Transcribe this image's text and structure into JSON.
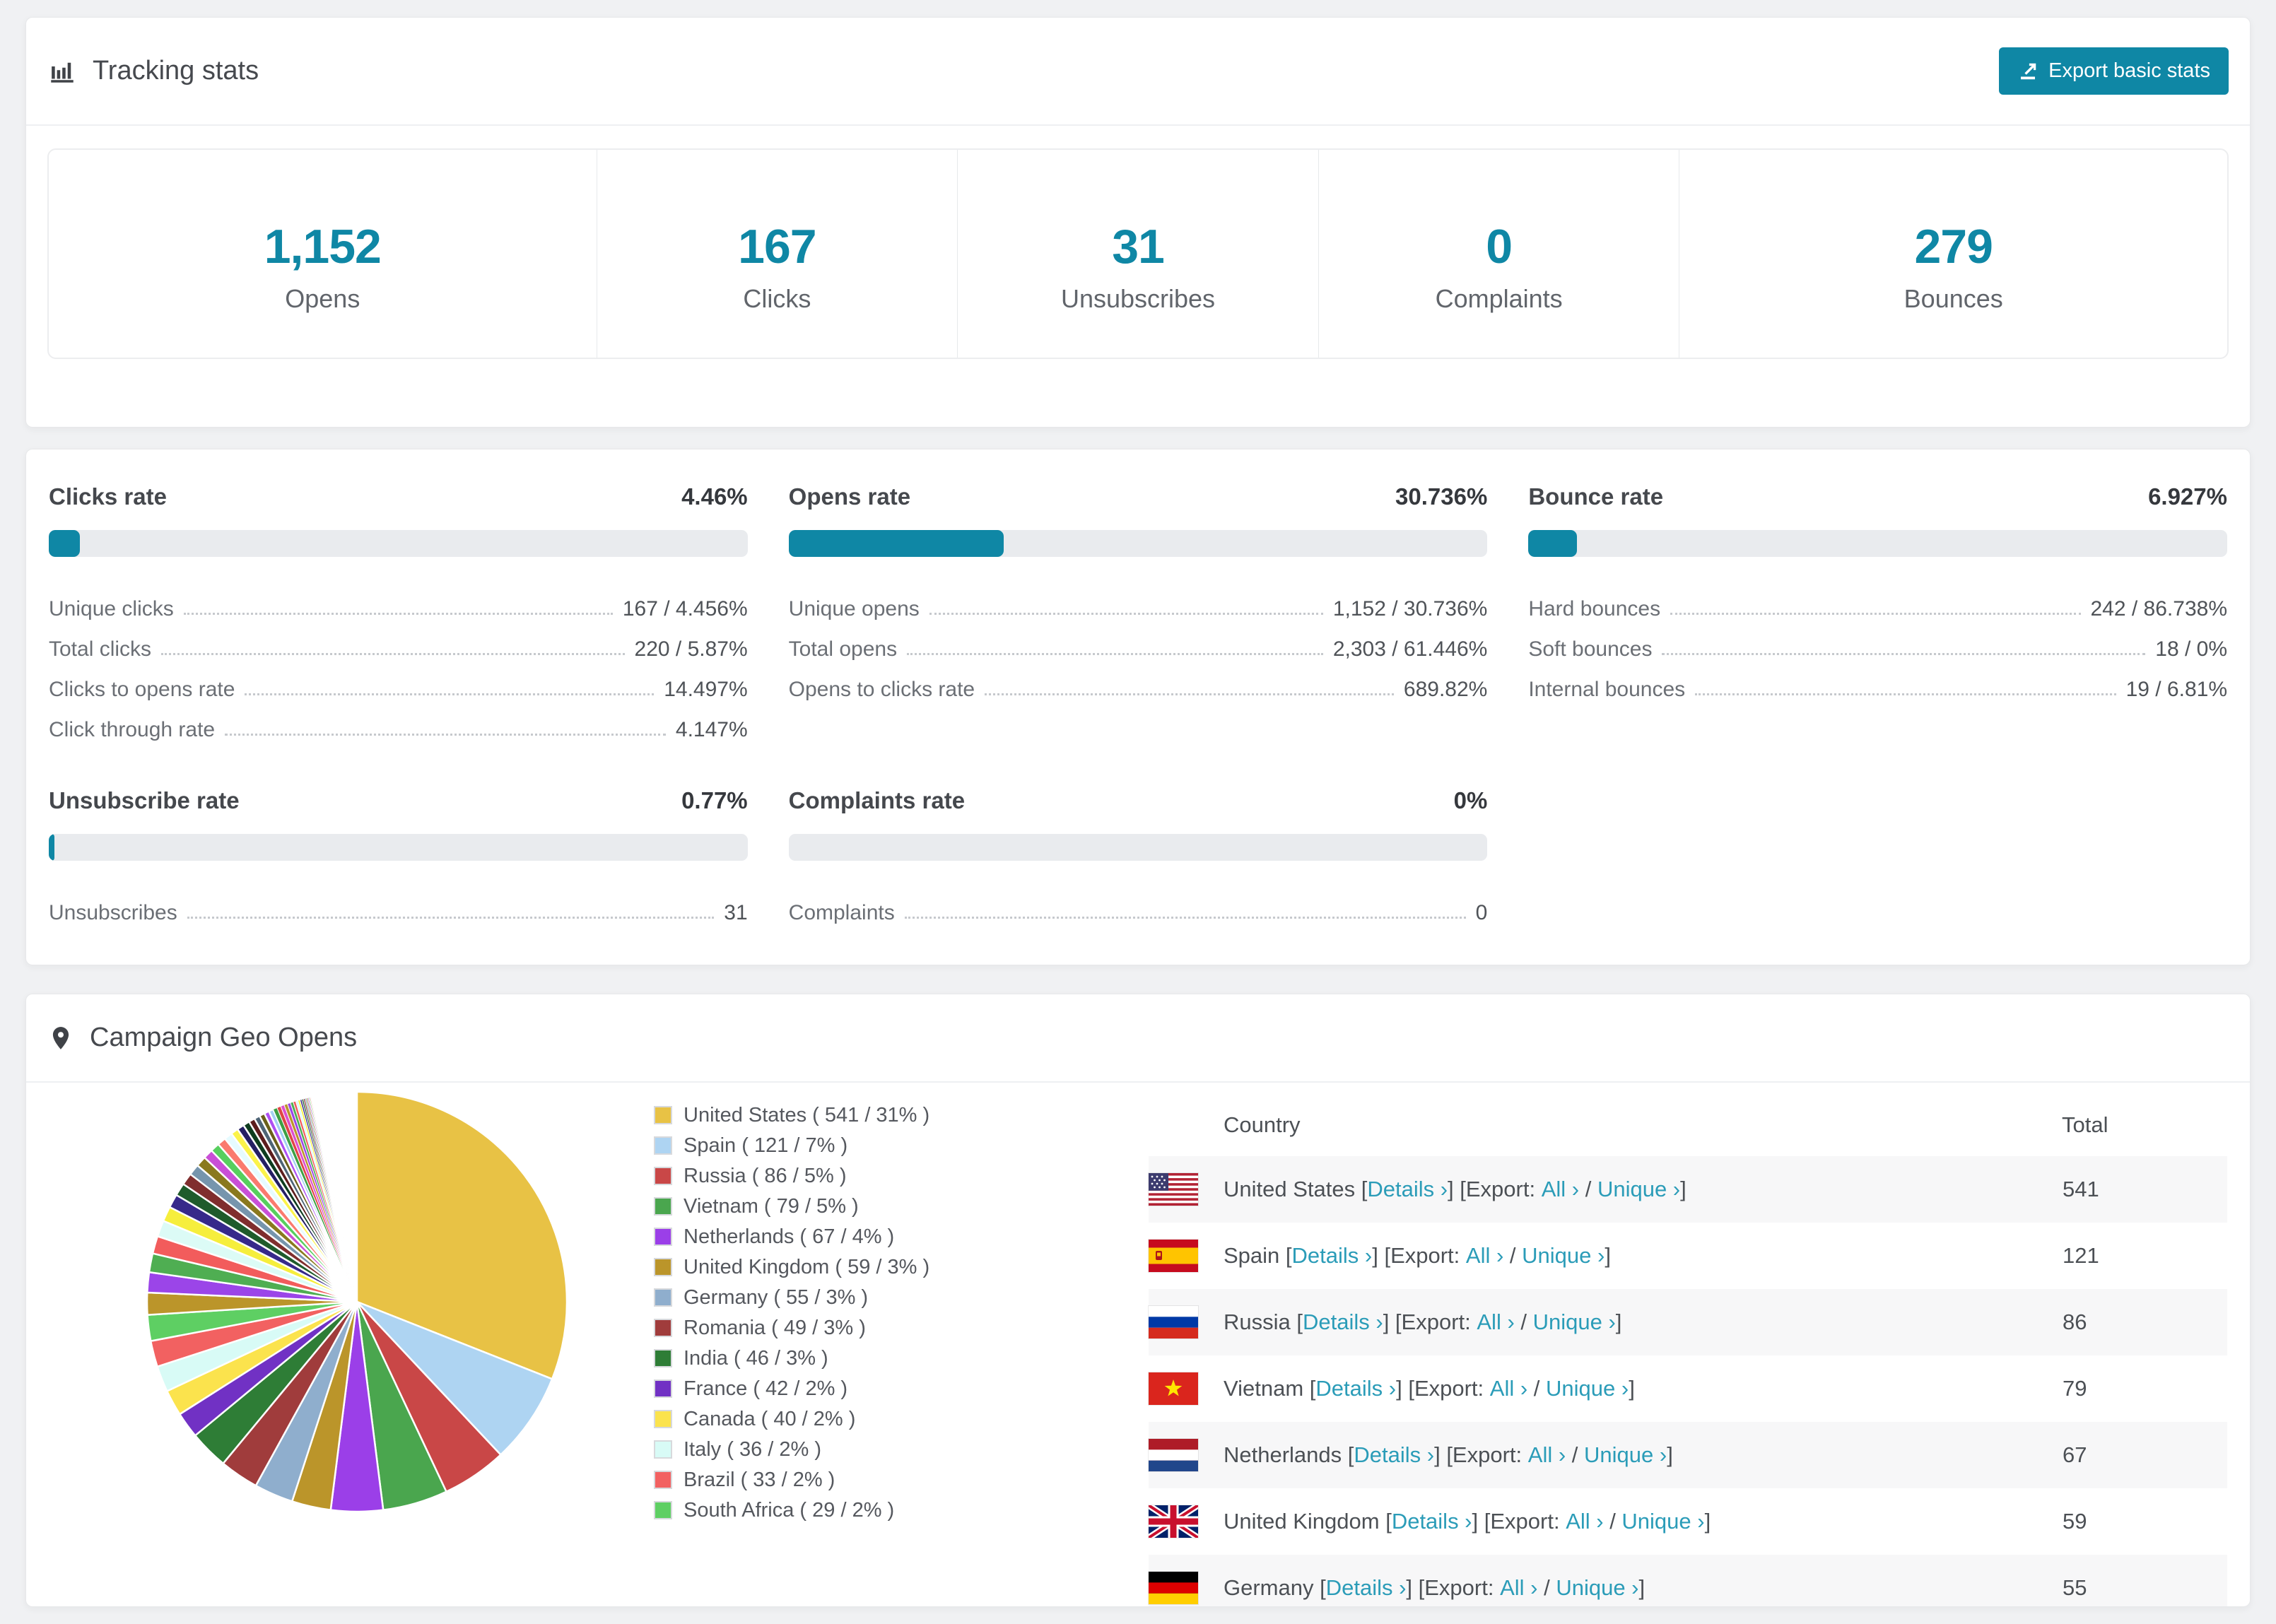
{
  "accent": "#0f87a5",
  "link_color": "#2b9cb8",
  "stripe_color": "#f7f7f8",
  "tracking": {
    "title": "Tracking stats",
    "export_label": "Export basic stats",
    "summary": [
      {
        "value": "1,152",
        "label": "Opens"
      },
      {
        "value": "167",
        "label": "Clicks"
      },
      {
        "value": "31",
        "label": "Unsubscribes"
      },
      {
        "value": "0",
        "label": "Complaints"
      },
      {
        "value": "279",
        "label": "Bounces"
      }
    ]
  },
  "rates": [
    {
      "title": "Clicks rate",
      "value": "4.46%",
      "percent": 4.46,
      "rows": [
        [
          "Unique clicks",
          "167 / 4.456%"
        ],
        [
          "Total clicks",
          "220 / 5.87%"
        ],
        [
          "Clicks to opens rate",
          "14.497%"
        ],
        [
          "Click through rate",
          "4.147%"
        ]
      ]
    },
    {
      "title": "Opens rate",
      "value": "30.736%",
      "percent": 30.736,
      "rows": [
        [
          "Unique opens",
          "1,152 / 30.736%"
        ],
        [
          "Total opens",
          "2,303 / 61.446%"
        ],
        [
          "Opens to clicks rate",
          "689.82%"
        ]
      ]
    },
    {
      "title": "Bounce rate",
      "value": "6.927%",
      "percent": 6.927,
      "rows": [
        [
          "Hard bounces",
          "242 / 86.738%"
        ],
        [
          "Soft bounces",
          "18 / 0%"
        ],
        [
          "Internal bounces",
          "19 / 6.81%"
        ]
      ]
    },
    {
      "title": "Unsubscribe rate",
      "value": "0.77%",
      "percent": 0.77,
      "rows": [
        [
          "Unsubscribes",
          "31"
        ]
      ]
    },
    {
      "title": "Complaints rate",
      "value": "0%",
      "percent": 0,
      "rows": [
        [
          "Complaints",
          "0"
        ]
      ]
    }
  ],
  "geo": {
    "title": "Campaign Geo Opens",
    "links": {
      "details": "Details ›",
      "export_prefix": "Export:",
      "all": "All ›",
      "unique": "Unique ›"
    },
    "table": {
      "columns": [
        "Country",
        "Total"
      ]
    }
  },
  "chart_data": {
    "type": "pie",
    "title": "Campaign Geo Opens",
    "legend_position": "right",
    "countries": [
      {
        "name": "United States",
        "count": 541,
        "pct": 31,
        "color": "#e8c245",
        "flag": "us"
      },
      {
        "name": "Spain",
        "count": 121,
        "pct": 7,
        "color": "#aed4f2",
        "flag": "es"
      },
      {
        "name": "Russia",
        "count": 86,
        "pct": 5,
        "color": "#c94747",
        "flag": "ru"
      },
      {
        "name": "Vietnam",
        "count": 79,
        "pct": 5,
        "color": "#4aa64e",
        "flag": "vn"
      },
      {
        "name": "Netherlands",
        "count": 67,
        "pct": 4,
        "color": "#9b3fe8",
        "flag": "nl"
      },
      {
        "name": "United Kingdom",
        "count": 59,
        "pct": 3,
        "color": "#bb952a",
        "flag": "gb"
      },
      {
        "name": "Germany",
        "count": 55,
        "pct": 3,
        "color": "#8faecd",
        "flag": "de"
      },
      {
        "name": "Romania",
        "count": 49,
        "pct": 3,
        "color": "#a03c3c"
      },
      {
        "name": "India",
        "count": 46,
        "pct": 3,
        "color": "#2e7d36"
      },
      {
        "name": "France",
        "count": 42,
        "pct": 2,
        "color": "#7131c4"
      },
      {
        "name": "Canada",
        "count": 40,
        "pct": 2,
        "color": "#fbe34d"
      },
      {
        "name": "Italy",
        "count": 36,
        "pct": 2,
        "color": "#d8fbf6"
      },
      {
        "name": "Brazil",
        "count": 33,
        "pct": 2,
        "color": "#f26161"
      },
      {
        "name": "South Africa",
        "count": 29,
        "pct": 2,
        "color": "#5ecf63"
      }
    ],
    "table_rows": 7,
    "others_pct": [
      1.7,
      1.55,
      1.45,
      1.35,
      1.25,
      1.15,
      1.05,
      0.98,
      0.92,
      0.86,
      0.8,
      0.75,
      0.7,
      0.66,
      0.62,
      0.58,
      0.54,
      0.5,
      0.47,
      0.44,
      0.41,
      0.38,
      0.35,
      0.32,
      0.3,
      0.28,
      0.26,
      0.24,
      0.22,
      0.2,
      0.18,
      0.16,
      0.14,
      0.13,
      0.12,
      0.11,
      0.1,
      0.09,
      0.08,
      0.07,
      0.06,
      0.05,
      0.05,
      0.04,
      0.04,
      0.03
    ],
    "others_palette": [
      "#bb952a",
      "#9b45e8",
      "#4fae52",
      "#f25c5c",
      "#dcfbf6",
      "#f6ee3c",
      "#37298a",
      "#1f5b2b",
      "#802e2e",
      "#7695ad",
      "#8a791e",
      "#c94fd6",
      "#57cf5e",
      "#fa7a6e",
      "#e6fbff",
      "#fbf34a",
      "#241f63",
      "#0e3d1f",
      "#5c1d1d",
      "#4e6476",
      "#6b601a",
      "#ae4ff2",
      "#a3d0f2",
      "#3da043",
      "#e04545",
      "#dd4fd0"
    ]
  }
}
